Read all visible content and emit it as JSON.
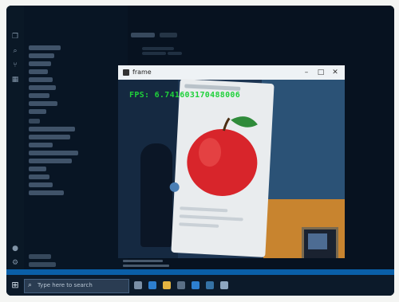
{
  "window": {
    "title": "frame",
    "minimize": "–",
    "maximize": "□",
    "close": "✕"
  },
  "overlay": {
    "fps_text": "FPS: 6.741603170488006"
  },
  "taskbar": {
    "search_placeholder": "Type here to search"
  },
  "colors": {
    "fps_text": "#1fd13a",
    "apple": "#d8252b",
    "leaf": "#2f8b3a",
    "status_bar": "#0a5fa8",
    "editor_bg": "#071220"
  },
  "icons": [
    "explorer-icon",
    "search-icon",
    "git-icon",
    "extensions-icon",
    "account-icon",
    "settings-icon",
    "windows-start-icon",
    "task-view-icon",
    "edge-icon",
    "file-explorer-icon",
    "store-icon",
    "mail-icon",
    "python-icon"
  ]
}
